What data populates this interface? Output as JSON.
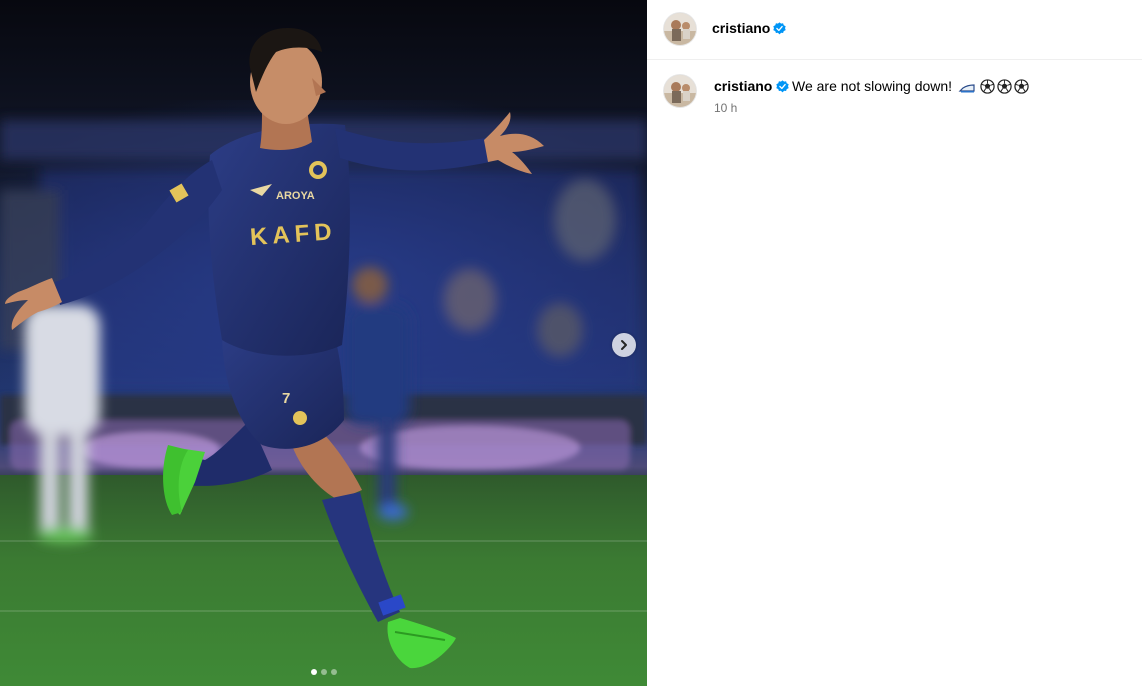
{
  "post": {
    "author": {
      "username": "cristiano",
      "verified": true,
      "verified_icon": "verified-badge-icon",
      "verified_color": "#0095f6"
    },
    "caption": {
      "username": "cristiano",
      "text": "We are not slowing down!",
      "emojis": [
        "iron-icon",
        "soccer-ball-icon",
        "soccer-ball-icon",
        "soccer-ball-icon"
      ]
    },
    "timestamp": "10 h",
    "media": {
      "carousel_count": 3,
      "carousel_index": 1,
      "next_icon": "chevron-right-icon",
      "jersey_sponsor": "KAFD",
      "jersey_sponsor_top": "AROYA",
      "jersey_number": "7"
    }
  },
  "colors": {
    "accent": "#0095f6",
    "secondary_text": "#737373",
    "divider": "#efefef"
  }
}
